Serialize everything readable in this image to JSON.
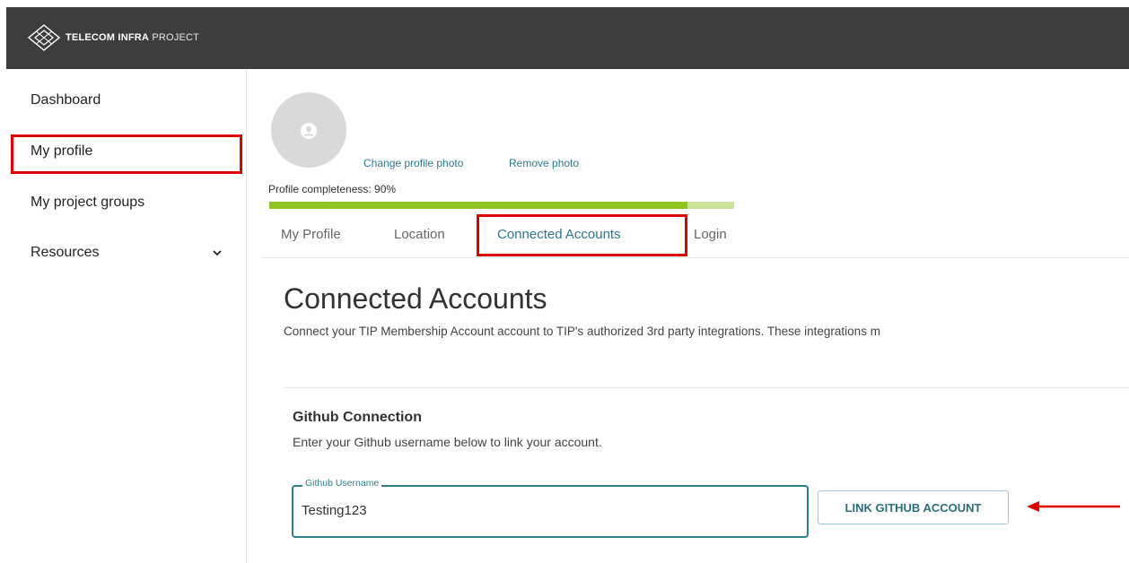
{
  "header": {
    "brand_bold": "TELECOM INFRA",
    "brand_light": "PROJECT",
    "logo_icon": "diamond-logo-icon",
    "background_color": "#3d3d3d"
  },
  "sidebar": {
    "items": [
      {
        "label": "Dashboard"
      },
      {
        "label": "My profile",
        "highlighted": true
      },
      {
        "label": "My project groups"
      },
      {
        "label": "Resources",
        "icon": "chevron-down-icon"
      }
    ]
  },
  "profile": {
    "avatar_icon": "user-circle-icon",
    "change_photo_label": "Change profile photo",
    "remove_photo_label": "Remove photo",
    "completeness_text": "Profile completeness: 90%",
    "completeness_value": 0.9
  },
  "tabs": [
    {
      "label": "My Profile"
    },
    {
      "label": "Location"
    },
    {
      "label": "Connected Accounts",
      "active": true,
      "highlighted": true
    },
    {
      "label": "Login"
    }
  ],
  "main": {
    "title": "Connected Accounts",
    "description": "Connect your TIP Membership Account account to TIP's authorized 3rd party integrations. These integrations m"
  },
  "github": {
    "heading": "Github Connection",
    "subtext": "Enter your Github username below to link your account.",
    "field_label": "Github Username",
    "field_value": "Testing123",
    "button_label": "LINK GITHUB ACCOUNT"
  },
  "colors": {
    "accent": "#2b7a8a",
    "highlight_box": "#e00000",
    "progress_fill": "#8fc31f",
    "progress_track": "#c9e39a"
  }
}
